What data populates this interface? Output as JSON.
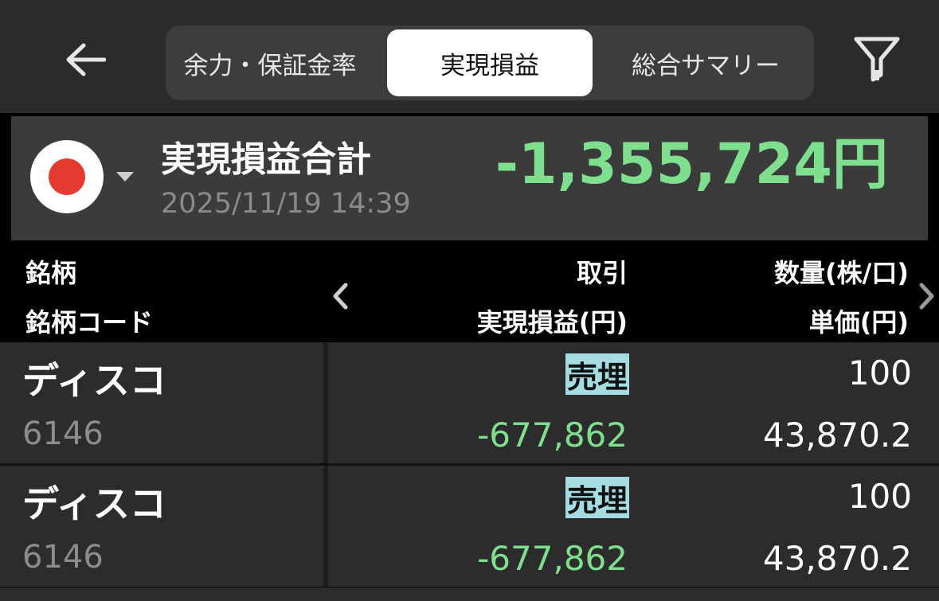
{
  "header": {
    "tabs": [
      {
        "label": "余力・保証金率",
        "active": false
      },
      {
        "label": "実現損益",
        "active": true
      },
      {
        "label": "総合サマリー",
        "active": false
      }
    ]
  },
  "summary": {
    "title": "実現損益合計",
    "value": "-1,355,724円",
    "datetime": "2025/11/19 14:39",
    "value_color": "#7ee08f"
  },
  "table": {
    "headers": {
      "col1_line1": "銘柄",
      "col1_line2": "銘柄コード",
      "col2_line1": "取引",
      "col2_line2": "実現損益(円)",
      "col3_line1": "数量(株/口)",
      "col3_line2": "単価(円)"
    },
    "rows": [
      {
        "name": "ディスコ",
        "code": "6146",
        "trade": "売埋",
        "pnl": "-677,862",
        "qty": "100",
        "price": "43,870.2"
      },
      {
        "name": "ディスコ",
        "code": "6146",
        "trade": "売埋",
        "pnl": "-677,862",
        "qty": "100",
        "price": "43,870.2"
      }
    ]
  },
  "icons": {
    "back": "arrow-left-icon",
    "filter": "filter-icon",
    "flag": "japan-flag-icon",
    "prev": "chevron-left-icon",
    "next": "chevron-right-icon"
  }
}
